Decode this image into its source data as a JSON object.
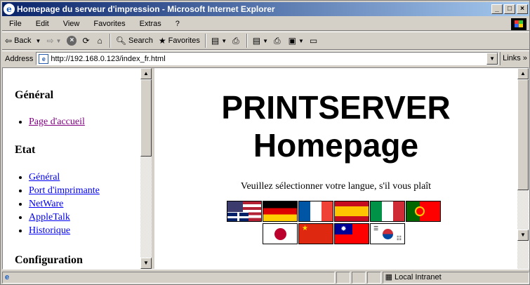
{
  "window": {
    "title": "Homepage du serveur d'impression - Microsoft Internet Explorer",
    "controls": [
      "_",
      "□",
      "×"
    ]
  },
  "menu": [
    "File",
    "Edit",
    "View",
    "Favorites",
    "Extras",
    "?"
  ],
  "toolbar": {
    "back_label": "Back",
    "search_label": "Search",
    "favorites_label": "Favorites"
  },
  "address": {
    "label": "Address",
    "url": "http://192.168.0.123/index_fr.html",
    "links_label": "Links"
  },
  "sidebar": {
    "sections": [
      {
        "heading": "Général",
        "items": [
          {
            "label": "Page d'accueil",
            "visited": true
          }
        ]
      },
      {
        "heading": "Etat",
        "items": [
          {
            "label": "Général",
            "visited": false
          },
          {
            "label": "Port d'imprimante",
            "visited": false
          },
          {
            "label": "NetWare",
            "visited": false
          },
          {
            "label": "AppleTalk",
            "visited": false
          },
          {
            "label": "Historique",
            "visited": false
          }
        ]
      },
      {
        "heading": "Configuration",
        "items": []
      }
    ]
  },
  "main": {
    "title_line1": "PRINTSERVER",
    "title_line2": "Homepage",
    "language_prompt": "Veuillez sélectionner votre langue, s'il vous plaît",
    "flags_row1": [
      "english",
      "german",
      "french",
      "spanish",
      "italian",
      "portuguese"
    ],
    "flags_row2": [
      "japanese",
      "chinese",
      "taiwanese",
      "korean"
    ]
  },
  "status": {
    "zone": "Local Intranet"
  }
}
